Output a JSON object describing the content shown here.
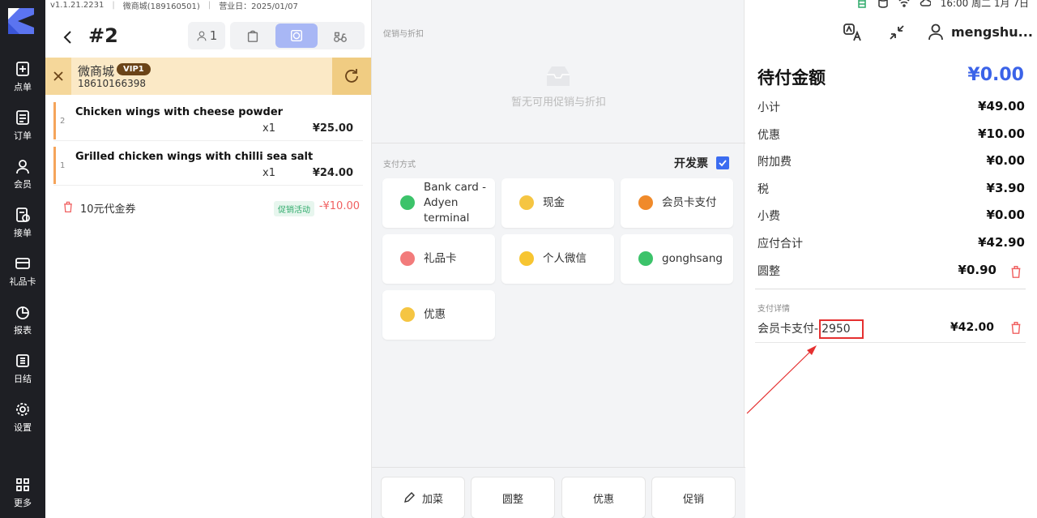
{
  "app": {
    "version": "v1.1.21.2231",
    "store": "微商城(189160501)",
    "business_date": "营业日：2025/01/07"
  },
  "nav": [
    {
      "label": "点单",
      "icon": "add-order-icon"
    },
    {
      "label": "订单",
      "icon": "order-list-icon"
    },
    {
      "label": "会员",
      "icon": "member-icon"
    },
    {
      "label": "接单",
      "icon": "accept-order-icon"
    },
    {
      "label": "礼品卡",
      "icon": "gift-card-icon"
    },
    {
      "label": "报表",
      "icon": "report-icon"
    },
    {
      "label": "日结",
      "icon": "daily-close-icon"
    },
    {
      "label": "设置",
      "icon": "settings-icon"
    },
    {
      "label": "更多",
      "icon": "more-grid-icon"
    }
  ],
  "order": {
    "number": "#2",
    "guests": "1",
    "active_type": "dine-in",
    "member": {
      "name": "微商城",
      "level": "VIP1",
      "phone": "18610166398"
    },
    "items": [
      {
        "index": "2",
        "name": "Chicken wings with cheese powder",
        "qty": "x1",
        "price": "¥25.00"
      },
      {
        "index": "1",
        "name": "Grilled chicken wings with chilli sea salt",
        "qty": "x1",
        "price": "¥24.00"
      }
    ],
    "coupon": {
      "name": "10元代金券",
      "tag": "促销活动",
      "amount": "-¥10.00"
    }
  },
  "middle": {
    "promo_title": "促销与折扣",
    "promo_empty": "暂无可用促销与折扣",
    "pay_title": "支付方式",
    "invoice_label": "开发票",
    "invoice_checked": true,
    "methods": [
      {
        "label": "Bank card - Adyen terminal",
        "color": "#3cc36a"
      },
      {
        "label": "现金",
        "color": "#f5c542"
      },
      {
        "label": "会员卡支付",
        "color": "#f08a2a"
      },
      {
        "label": "礼品卡",
        "color": "#f27b7b"
      },
      {
        "label": "个人微信",
        "color": "#f7c531"
      },
      {
        "label": "gonghsang",
        "color": "#3cc36a"
      },
      {
        "label": "优惠",
        "color": "#f5c542"
      }
    ],
    "actions": [
      {
        "label": "加菜",
        "icon": "edit-icon"
      },
      {
        "label": "圆整"
      },
      {
        "label": "优惠"
      },
      {
        "label": "促销"
      }
    ]
  },
  "right": {
    "status_time": "16:00 周二 1月 7日",
    "user": "mengshu...",
    "due_label": "待付金额",
    "due_value": "¥0.00",
    "rows": [
      {
        "label": "小计",
        "value": "¥49.00"
      },
      {
        "label": "优惠",
        "value": "¥10.00"
      },
      {
        "label": "附加费",
        "value": "¥0.00"
      },
      {
        "label": "税",
        "value": "¥3.90"
      },
      {
        "label": "小费",
        "value": "¥0.00"
      },
      {
        "label": "应付合计",
        "value": "¥42.90"
      },
      {
        "label": "圆整",
        "value": "¥0.90"
      }
    ],
    "detail_title": "支付详情",
    "detail_method": "会员卡支付-",
    "detail_card": "2950",
    "detail_amount": "¥42.00"
  }
}
